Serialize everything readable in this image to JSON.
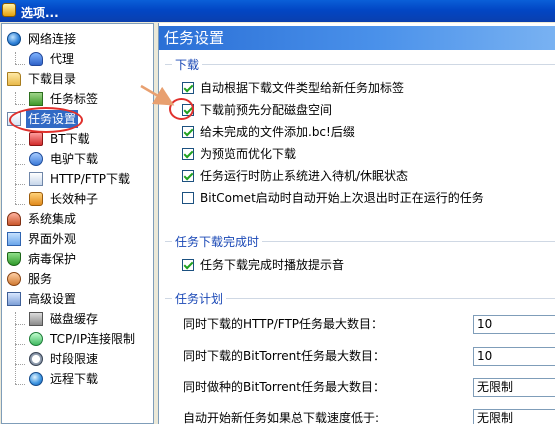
{
  "window": {
    "title": "选项..."
  },
  "tree": {
    "items": [
      {
        "label": "网络连接",
        "icon": "globe-icon"
      },
      {
        "label": "代理",
        "icon": "proxy-person-icon"
      },
      {
        "label": "下载目录",
        "icon": "folder-icon"
      },
      {
        "label": "任务标签",
        "icon": "tag-icon"
      },
      {
        "label": "任务设置",
        "icon": "task-icon",
        "selected": true
      },
      {
        "label": "BT下载",
        "icon": "bt-icon"
      },
      {
        "label": "电驴下载",
        "icon": "emule-icon"
      },
      {
        "label": "HTTP/FTP下载",
        "icon": "http-icon"
      },
      {
        "label": "长效种子",
        "icon": "seed-icon"
      },
      {
        "label": "系统集成",
        "icon": "people-icon"
      },
      {
        "label": "界面外观",
        "icon": "interface-icon"
      },
      {
        "label": "病毒保护",
        "icon": "shield-icon"
      },
      {
        "label": "服务",
        "icon": "service-icon"
      },
      {
        "label": "高级设置",
        "icon": "advanced-icon"
      },
      {
        "label": "磁盘缓存",
        "icon": "disk-icon"
      },
      {
        "label": "TCP/IP连接限制",
        "icon": "network-icon"
      },
      {
        "label": "时段限速",
        "icon": "clock-icon"
      },
      {
        "label": "远程下载",
        "icon": "remote-globe-icon"
      }
    ]
  },
  "panel": {
    "title": "任务设置",
    "download_group": {
      "title": "下载",
      "options": [
        {
          "label": "自动根据下载文件类型给新任务加标签",
          "checked": true
        },
        {
          "label": "下载前预先分配磁盘空间",
          "checked": true
        },
        {
          "label": "给未完成的文件添加.bc!后缀",
          "checked": true
        },
        {
          "label": "为预览而优化下载",
          "checked": true
        },
        {
          "label": "任务运行时防止系统进入待机/休眠状态",
          "checked": true
        },
        {
          "label": "BitComet启动时自动开始上次退出时正在运行的任务",
          "checked": false
        }
      ]
    },
    "complete_group": {
      "title": "任务下载完成时",
      "options": [
        {
          "label": "任务下载完成时播放提示音",
          "checked": true
        }
      ]
    },
    "schedule_group": {
      "title": "任务计划",
      "fields": [
        {
          "label": "同时下载的HTTP/FTP任务最大数目：",
          "value": "10"
        },
        {
          "label": "同时下载的BitTorrent任务最大数目：",
          "value": "10"
        },
        {
          "label": "同时做种的BitTorrent任务最大数目：",
          "value": "无限制"
        },
        {
          "label": "自动开始新任务如果总下载速度低于:",
          "value": "无限制"
        }
      ]
    }
  },
  "annotation": {
    "color": "#e0302c"
  }
}
